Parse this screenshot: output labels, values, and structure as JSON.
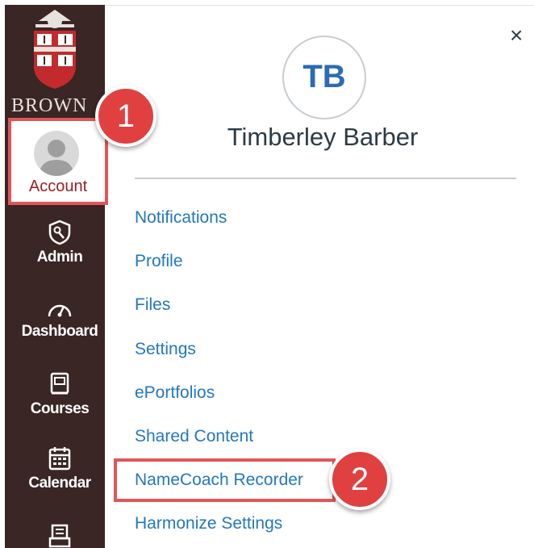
{
  "nav": {
    "brand": "BROWN",
    "account_label": "Account",
    "items": [
      {
        "label": "Admin",
        "icon": "shield-icon"
      },
      {
        "label": "Dashboard",
        "icon": "speedometer-icon"
      },
      {
        "label": "Courses",
        "icon": "courses-book-icon"
      },
      {
        "label": "Calendar",
        "icon": "calendar-icon"
      }
    ]
  },
  "panel": {
    "initials": "TB",
    "user_name": "Timberley Barber",
    "close_label": "×",
    "links": [
      "Notifications",
      "Profile",
      "Files",
      "Settings",
      "ePortfolios",
      "Shared Content",
      "NameCoach Recorder",
      "Harmonize Settings"
    ]
  },
  "callouts": {
    "step1": "1",
    "step2": "2"
  },
  "colors": {
    "nav_bg": "#3a2624",
    "link": "#2377c2",
    "callout": "#e05759",
    "initials": "#2d6bb5"
  }
}
